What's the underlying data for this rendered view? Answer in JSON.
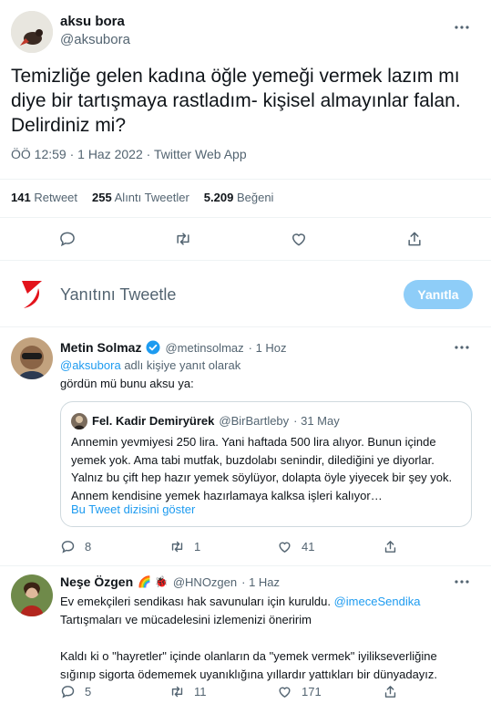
{
  "main_tweet": {
    "author_name": "aksu bora",
    "author_handle": "@aksubora",
    "text": "Temizliğe gelen kadına öğle yemeği vermek lazım mı diye bir tartışmaya rastladım- kişisel almayınlar falan. Delirdiniz mi?",
    "meta": "ÖÖ 12:59 · 1 Haz 2022 · Twitter Web App",
    "stats": {
      "retweets_count": "141",
      "retweets_label": "Retweet",
      "quotes_count": "255",
      "quotes_label": "Alıntı Tweetler",
      "likes_count": "5.209",
      "likes_label": "Beğeni"
    }
  },
  "reply_box": {
    "placeholder": "Yanıtını Tweetle",
    "button_label": "Yanıtla"
  },
  "replies": [
    {
      "name": "Metin Solmaz",
      "handle": "@metinsolmaz",
      "time": "· 1 Hoz",
      "reply_to_handle": "@aksubora",
      "reply_to_suffix": "adlı kişiye yanıt olarak",
      "text": "gördün mü bunu aksu ya:",
      "quote": {
        "name": "Fel. Kadir Demiryürek",
        "handle": "@BirBartleby",
        "time": "· 31 May",
        "text": "Annemin yevmiyesi 250 lira. Yani haftada 500 lira alıyor. Bunun içinde yemek yok. Ama tabi mutfak, buzdolabı senindir, dilediğini ye diyorlar. Yalnız bu çift hep hazır yemek söylüyor, dolapta öyle yiyecek bir şey yok. Annem kendisine yemek hazırlamaya kalksa işleri kalıyor…",
        "thread_link": "Bu Tweet dizisini göster"
      },
      "reply_count": "8",
      "retweet_count": "1",
      "like_count": "41"
    },
    {
      "name": "Neşe Özgen",
      "emoji": "🌈 🐞",
      "handle": "@HNOzgen",
      "time": "· 1 Haz",
      "text_line1": "Ev emekçileri sendikası hak savunuları için kuruldu.",
      "mention": "@imeceSendika",
      "text_line2": "Tartışmaları ve mücadelesini izlemenizi öneririm",
      "text_para2": "Kaldı ki o \"hayretler\" içinde olanların da \"yemek vermek\" iyilikseverliğine sığınıp sigorta ödememek uyanıklığına yıllardır yattıkları bir dünyadayız.",
      "reply_count": "5",
      "retweet_count": "11",
      "like_count": "171"
    }
  ],
  "colors": {
    "accent": "#1d9bf0",
    "muted": "#536471",
    "brand_logo": "#e3131b",
    "button_disabled": "#8ecdf8"
  },
  "icons": [
    "more-icon",
    "reply-icon",
    "retweet-icon",
    "like-icon",
    "share-icon",
    "verified-icon"
  ]
}
